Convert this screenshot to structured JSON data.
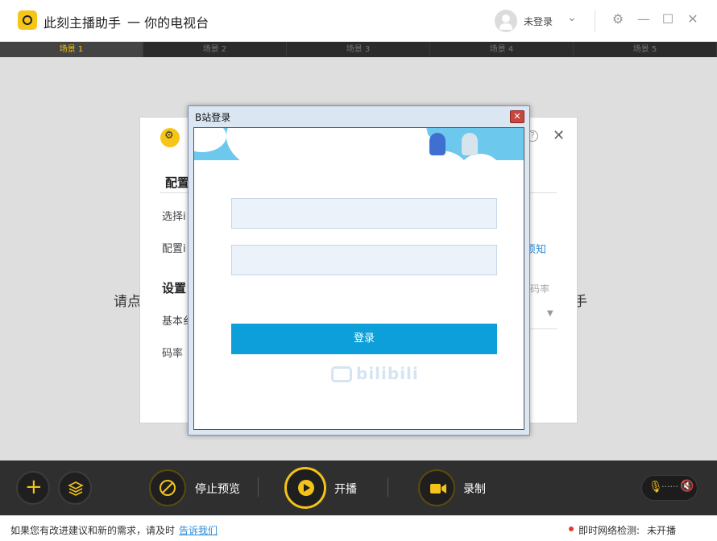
{
  "app": {
    "title": "此刻主播助手",
    "subtitle": "一 你的电视台",
    "user_status": "未登录"
  },
  "scenes": [
    "场景 1",
    "场景 2",
    "场景 3",
    "场景 4",
    "场景 5"
  ],
  "active_scene": 0,
  "main": {
    "left_text": "请点",
    "right_text": "手"
  },
  "config_panel": {
    "section1": "配置",
    "row1": "选择i",
    "row2": "配置i",
    "link": "须知",
    "section2": "设置",
    "row3": "基本纟",
    "row4": "码率",
    "rate_label": "码率"
  },
  "dialog": {
    "title": "B站登录",
    "username_placeholder": "",
    "password_placeholder": "",
    "login_label": "登录",
    "logo_text": "bilibili"
  },
  "toolbar": {
    "stop_preview": "停止预览",
    "start_broadcast": "开播",
    "record": "录制"
  },
  "status": {
    "feedback_text": "如果您有改进建议和新的需求，请及时",
    "feedback_link": "告诉我们",
    "network_label": "即时网络检测:",
    "network_value": "未开播"
  },
  "colors": {
    "accent": "#f3c319",
    "toolbar_bg": "#2f2f2f",
    "login_button": "#0c9fd9",
    "banner_sky": "#6dc8ed",
    "link": "#2d8cd8"
  }
}
